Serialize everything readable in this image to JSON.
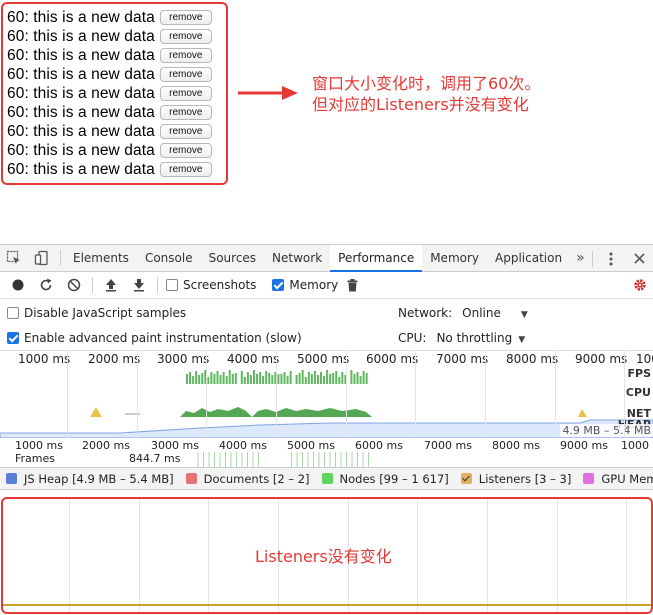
{
  "demo": {
    "row_text": "60: this is a new data",
    "remove_label": "remove",
    "row_count": 9
  },
  "annotation": {
    "line1": "窗口大小变化时，调用了60次。",
    "line2": "但对应的Listeners并没有变化"
  },
  "devtools": {
    "tabs": [
      "Elements",
      "Console",
      "Sources",
      "Network",
      "Performance",
      "Memory",
      "Application"
    ],
    "active_tab": "Performance",
    "more_tabs": "»",
    "toolbar": {
      "screenshots_label": "Screenshots",
      "screenshots_checked": false,
      "memory_label": "Memory",
      "memory_checked": true
    },
    "settings": {
      "disable_js_samples": "Disable JavaScript samples",
      "enable_paint": "Enable advanced paint instrumentation (slow)",
      "network_label": "Network:",
      "network_value": "Online",
      "cpu_label": "CPU:",
      "cpu_value": "No throttling"
    },
    "overview": {
      "ticks": [
        "1000 ms",
        "2000 ms",
        "3000 ms",
        "4000 ms",
        "5000 ms",
        "6000 ms",
        "7000 ms",
        "8000 ms",
        "9000 ms",
        "100"
      ],
      "labels": [
        "FPS",
        "CPU",
        "NET",
        "HEAP"
      ],
      "heap_range": "4.9 MB – 5.4 MB"
    },
    "frames": {
      "ticks": [
        "1000 ms",
        "2000 ms",
        "3000 ms",
        "4000 ms",
        "5000 ms",
        "6000 ms",
        "7000 ms",
        "8000 ms",
        "9000 ms",
        "1000"
      ],
      "label": "Frames",
      "duration": "844.7 ms"
    },
    "legend": [
      {
        "label": "JS Heap [4.9 MB – 5.4 MB]",
        "color": "#5b7fd6",
        "checked": false
      },
      {
        "label": "Documents [2 – 2]",
        "color": "#e57373",
        "checked": false
      },
      {
        "label": "Nodes [99 – 1 617]",
        "color": "#5fd35f",
        "checked": false
      },
      {
        "label": "Listeners [3 – 3]",
        "color": "#e0b060",
        "checked": true
      },
      {
        "label": "GPU Memory",
        "color": "#e070e0",
        "checked": false
      }
    ]
  },
  "memgraph_note": "Listeners没有变化"
}
